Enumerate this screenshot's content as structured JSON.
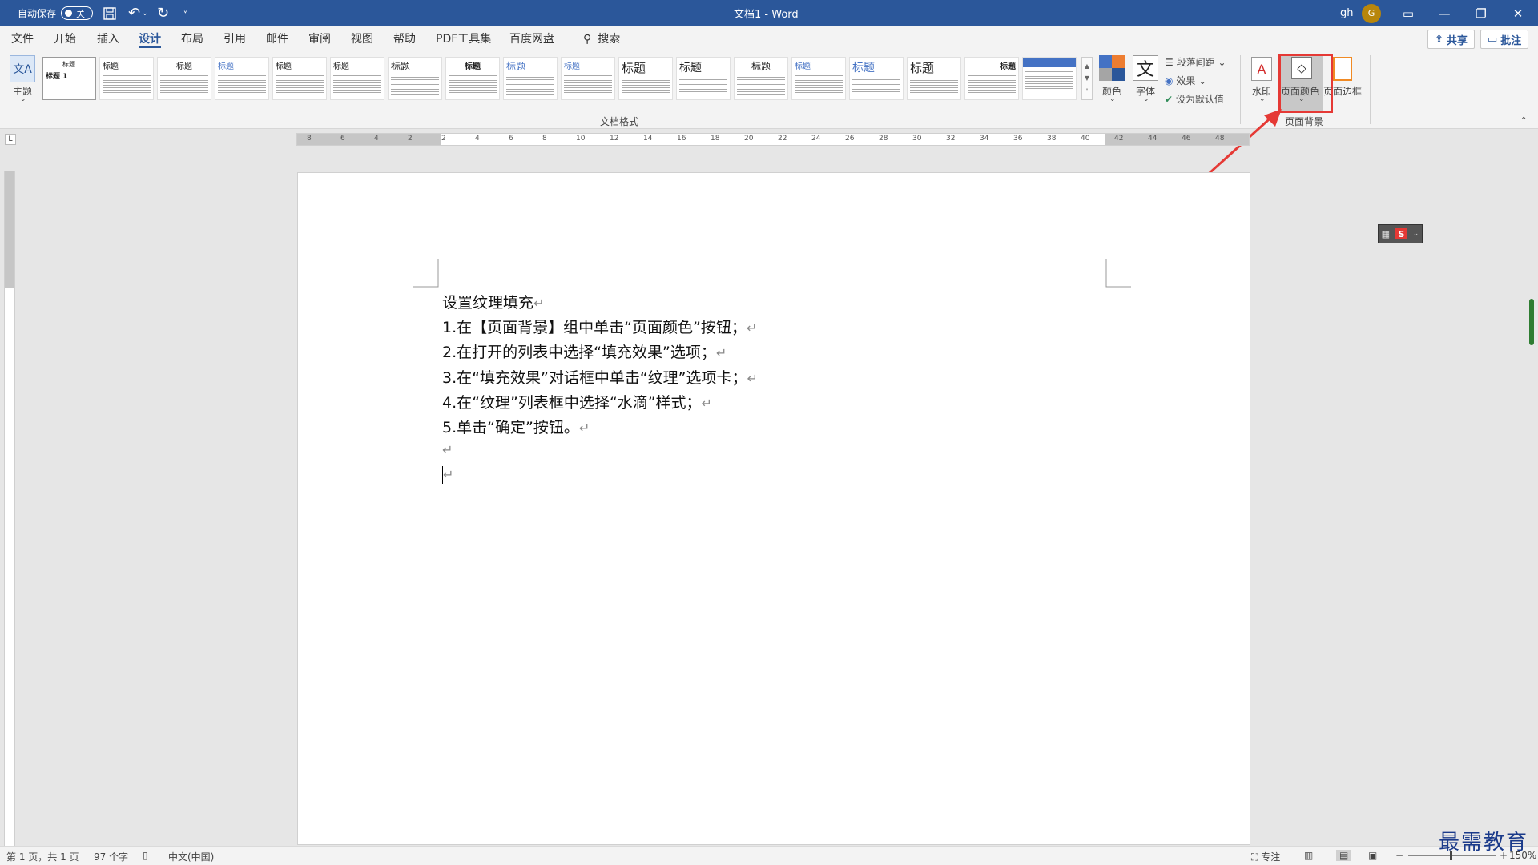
{
  "titlebar": {
    "autosave_label": "自动保存",
    "autosave_state": "关",
    "doc_title": "文档1 - Word",
    "user_name": "gh",
    "avatar_initial": "G",
    "accent_color": "#2b579a"
  },
  "menu": {
    "tabs": [
      "文件",
      "开始",
      "插入",
      "设计",
      "布局",
      "引用",
      "邮件",
      "审阅",
      "视图",
      "帮助",
      "PDF工具集",
      "百度网盘"
    ],
    "active_tab": "设计",
    "search_label": "搜索",
    "share_label": "共享",
    "comment_label": "批注"
  },
  "ribbon": {
    "theme_label": "主题",
    "style_titles": [
      "标题",
      "标题",
      "标题",
      "标题",
      "标题",
      "标题",
      "标题",
      "标题",
      "标题",
      "标题",
      "标题",
      "标题",
      "标题",
      "标题",
      "标题",
      "标题",
      "标题"
    ],
    "first_thumb_title": "标题 1",
    "doc_format_group": "文档格式",
    "colors_label": "颜色",
    "fonts_label": "字体",
    "para_spacing_label": "段落间距",
    "effects_label": "效果",
    "set_default_label": "设为默认值",
    "watermark_label": "水印",
    "page_color_label": "页面颜色",
    "page_border_label": "页面边框",
    "page_bg_group": "页面背景"
  },
  "ruler": {
    "numbers": [
      "8",
      "6",
      "4",
      "2",
      "2",
      "4",
      "6",
      "8",
      "10",
      "12",
      "14",
      "16",
      "18",
      "20",
      "22",
      "24",
      "26",
      "28",
      "30",
      "32",
      "34",
      "36",
      "38",
      "40",
      "42",
      "44",
      "46",
      "48"
    ]
  },
  "document": {
    "lines": [
      "设置纹理填充",
      "1.在【页面背景】组中单击“页面颜色”按钮；",
      "2.在打开的列表中选择“填充效果”选项；",
      "3.在“填充效果”对话框中单击“纹理”选项卡；",
      "4.在“纹理”列表框中选择“水滴”样式；",
      "5.单击“确定”按钮。"
    ],
    "pilcrow": "↵"
  },
  "statusbar": {
    "page_info": "第 1 页，共 1 页",
    "word_count": "97 个字",
    "language": "中文(中国)",
    "focus_label": "专注",
    "zoom_label": "150%"
  },
  "watermark_brand": "最需教育"
}
